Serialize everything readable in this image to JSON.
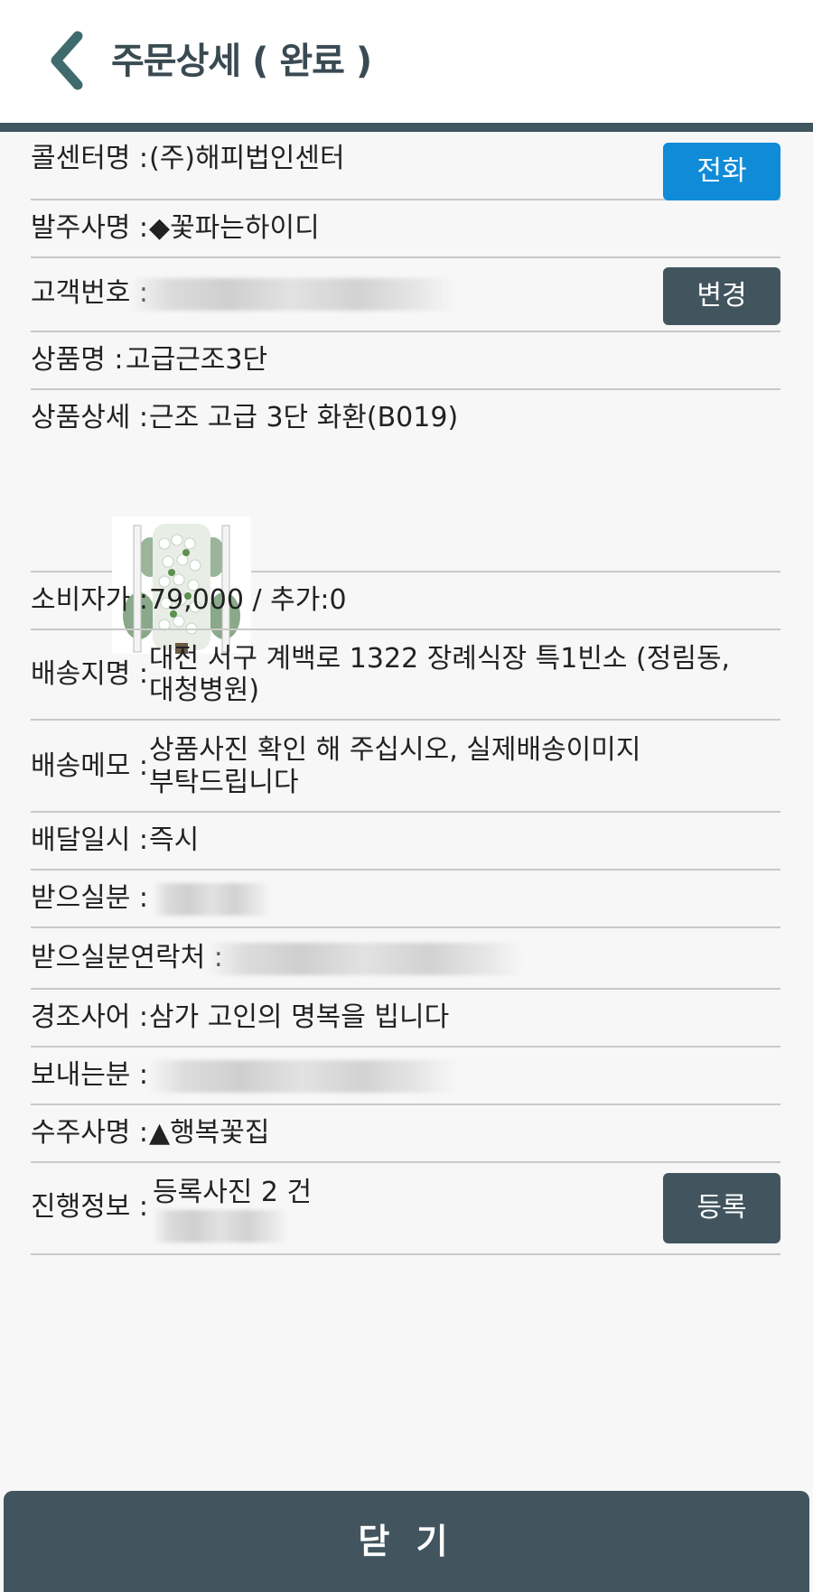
{
  "header": {
    "title": "주문상세 ( 완료 )"
  },
  "rows": {
    "callcenter": {
      "label": "콜센터명 :",
      "value": "(주)해피법인센터",
      "button": "전화"
    },
    "orderer": {
      "label": "발주사명 :",
      "value": "◆꽃파는하이디"
    },
    "customer_no": {
      "label": "고객번호 :",
      "button": "변경"
    },
    "product_name": {
      "label": "상품명 :",
      "value": "고급근조3단"
    },
    "product_detail": {
      "label": "상품상세 :",
      "value": "근조 고급 3단 화환(B019)"
    },
    "price": {
      "label": "소비자가 :",
      "value": "79,000 / 추가:0"
    },
    "address": {
      "label": "배송지명 :",
      "line1": "대전 서구 계백로 1322 장례식장 특1빈소  (정림동,",
      "line2": "대청병원)"
    },
    "memo": {
      "label": "배송메모 :",
      "line1": "상품사진 확인 해 주십시오, 실제배송이미지",
      "line2": "부탁드립니다"
    },
    "delivery_time": {
      "label": "배달일시 :",
      "value": "즉시"
    },
    "recipient": {
      "label": "받으실분 :"
    },
    "recipient_phone": {
      "label": "받으실분연락처 :"
    },
    "message": {
      "label": "경조사어 :",
      "value": "삼가 고인의 명복을 빕니다"
    },
    "sender": {
      "label": "보내는분 :"
    },
    "receiver_shop": {
      "label": "수주사명 :",
      "value": "▲행복꽃집"
    },
    "progress": {
      "label": "진행정보 :",
      "line1": "등록사진 2 건",
      "button": "등록"
    }
  },
  "footer": {
    "close_label": "닫 기"
  },
  "colors": {
    "accent_blue": "#0f8bd8",
    "dark_button": "#42555f",
    "header_bar": "#3f5560",
    "back_icon": "#3f6b6e"
  }
}
